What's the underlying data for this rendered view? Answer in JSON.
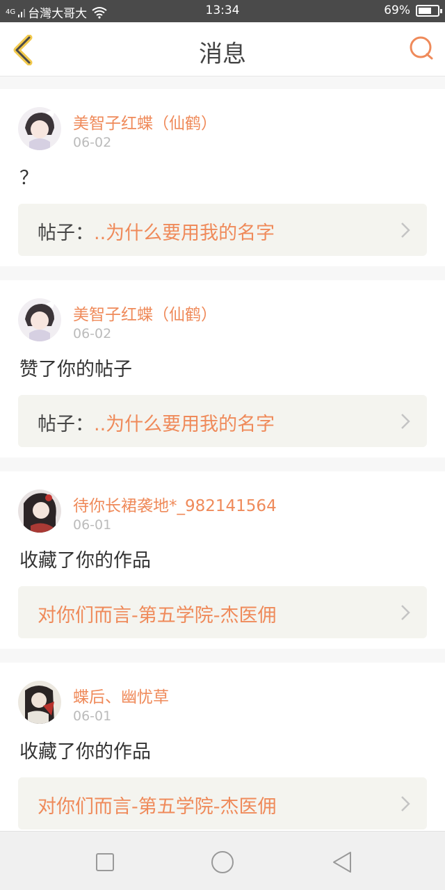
{
  "status_bar": {
    "network": "4G",
    "carrier": "台灣大哥大",
    "time": "13:34",
    "battery": "69%",
    "battery_level": 0.69
  },
  "header": {
    "title": "消息",
    "back_icon": "chevron-left-icon",
    "search_icon": "chat-bubble-icon"
  },
  "colors": {
    "accent": "#ef8a5a",
    "back_arrow": "#f2c94c",
    "link_bg": "#f4f4ef"
  },
  "messages": [
    {
      "user": "美智子红蝶（仙鹤）",
      "date": "06-02",
      "content": "？",
      "link_prefix": "帖子：",
      "link_title": "..为什么要用我的名字"
    },
    {
      "user": "美智子红蝶（仙鹤）",
      "date": "06-02",
      "content": "赞了你的帖子",
      "link_prefix": "帖子：",
      "link_title": "..为什么要用我的名字"
    },
    {
      "user": "待你长裙袭地*_982141564",
      "date": "06-01",
      "content": "收藏了你的作品",
      "link_prefix": "",
      "link_title": "对你们而言-第五学院-杰医佣"
    },
    {
      "user": "蝶后、幽忧草",
      "date": "06-01",
      "content": "收藏了你的作品",
      "link_prefix": "",
      "link_title": "对你们而言-第五学院-杰医佣"
    }
  ],
  "nav": {
    "recent_icon": "square-icon",
    "home_icon": "circle-icon",
    "back_icon": "triangle-back-icon"
  }
}
